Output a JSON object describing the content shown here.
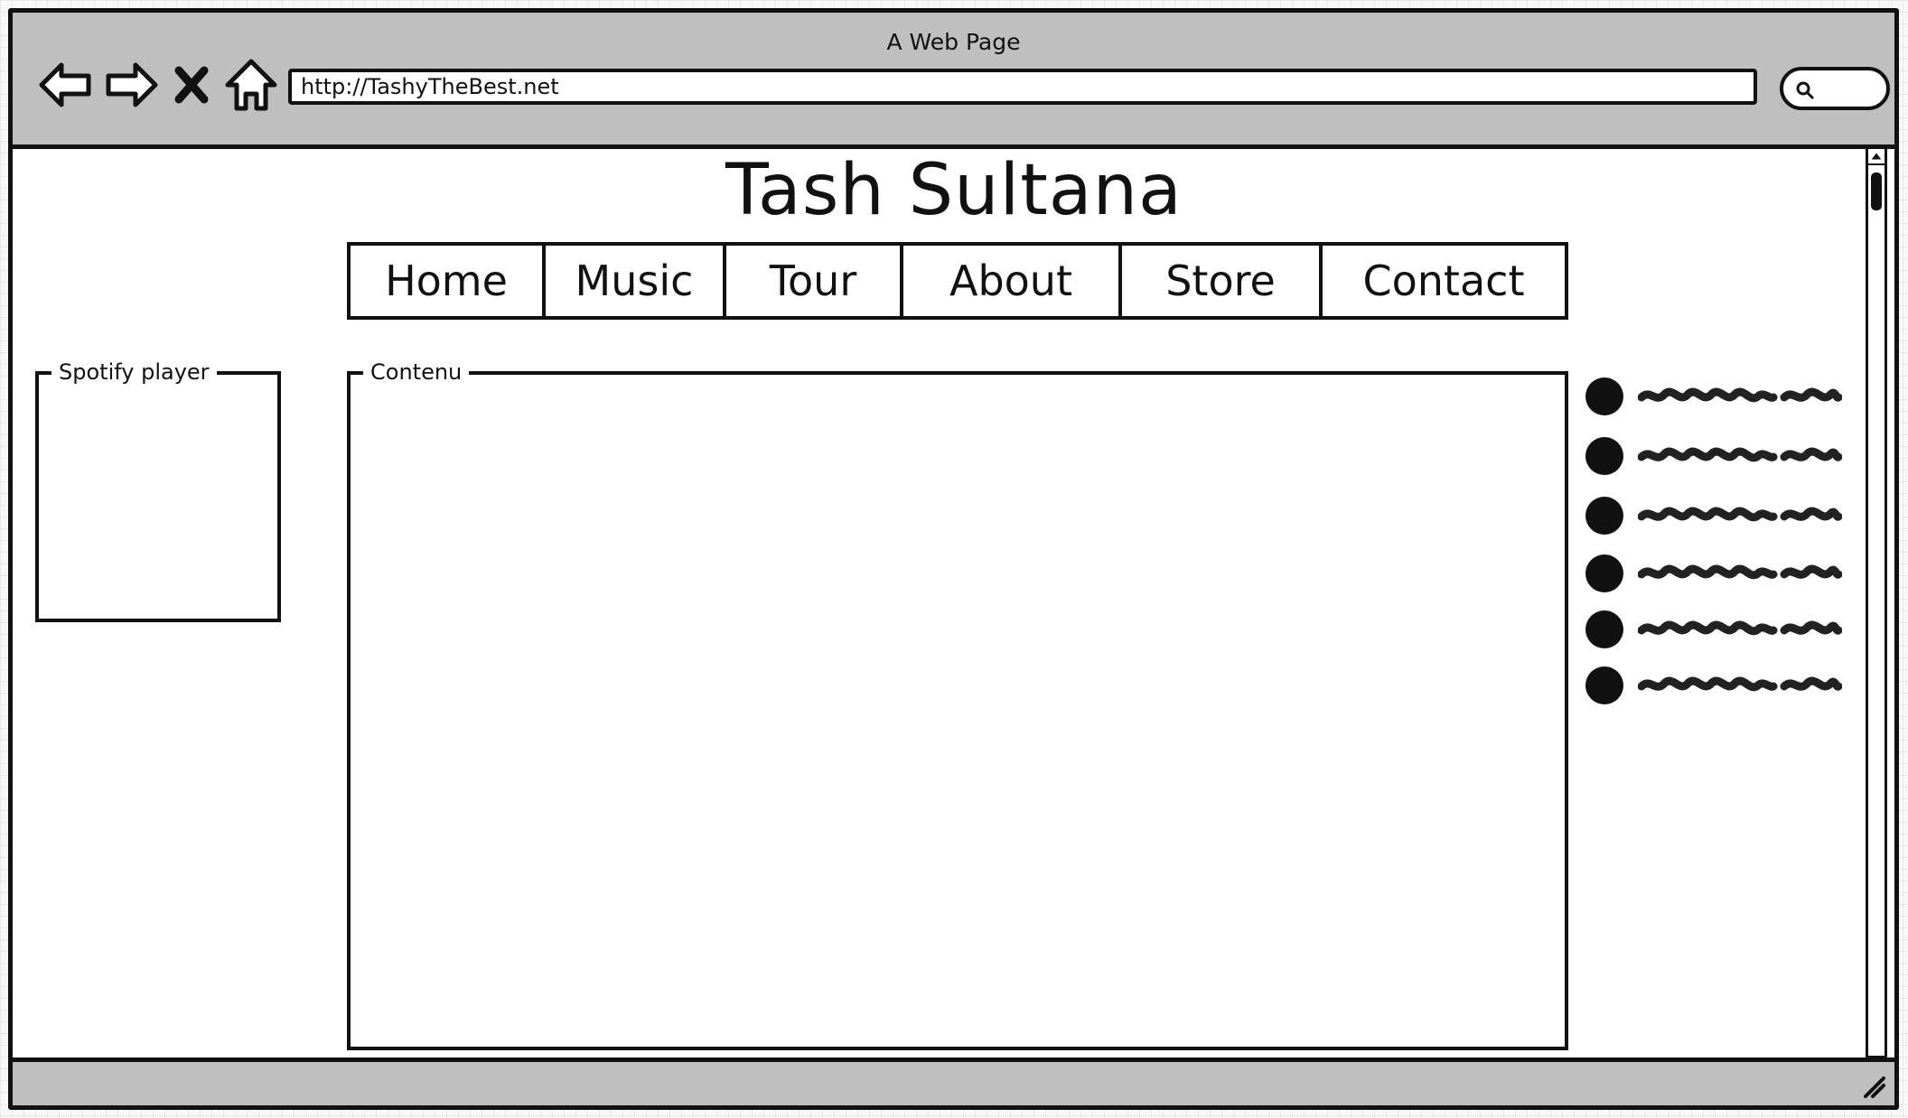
{
  "browser": {
    "window_title": "A Web Page",
    "url": "http://TashyTheBest.net"
  },
  "page": {
    "title": "Tash Sultana",
    "nav": [
      "Home",
      "Music",
      "Tour",
      "About",
      "Store",
      "Contact"
    ],
    "spotify_label": "Spotify player",
    "content_label": "Contenu",
    "bullet_count": 6
  },
  "icons": {
    "back": "back-arrow-icon",
    "forward": "forward-arrow-icon",
    "stop": "close-icon",
    "home": "home-icon",
    "search": "search-icon"
  }
}
